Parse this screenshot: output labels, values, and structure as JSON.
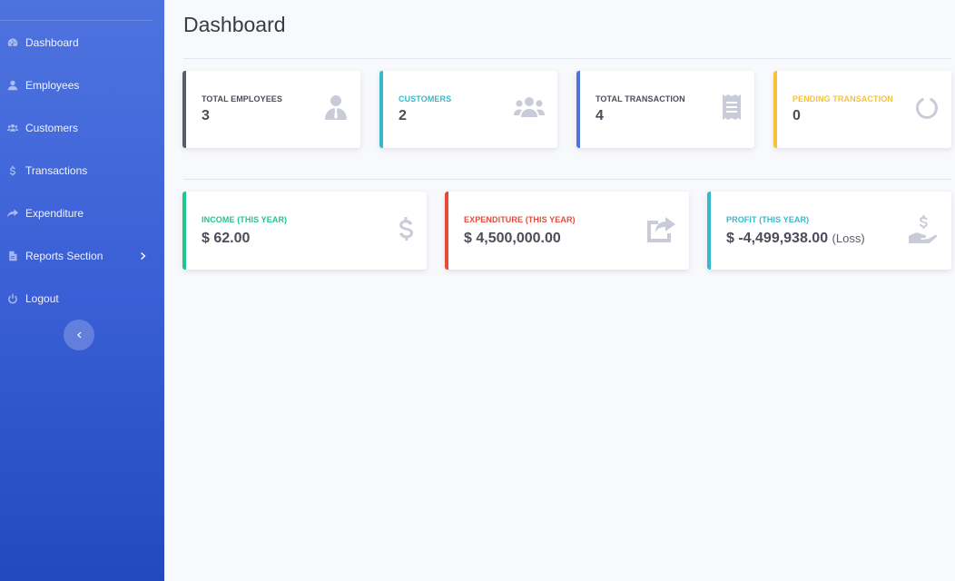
{
  "sidebar": {
    "items": [
      {
        "label": "Dashboard",
        "icon": "tachometer-icon"
      },
      {
        "label": "Employees",
        "icon": "user-icon"
      },
      {
        "label": "Customers",
        "icon": "users-icon"
      },
      {
        "label": "Transactions",
        "icon": "dollar-icon"
      },
      {
        "label": "Expenditure",
        "icon": "share-icon"
      },
      {
        "label": "Reports Section",
        "icon": "file-icon"
      },
      {
        "label": "Logout",
        "icon": "power-icon"
      }
    ]
  },
  "page": {
    "title": "Dashboard"
  },
  "stats": [
    {
      "label": "TOTAL EMPLOYEES",
      "value": "3",
      "color": "#5a5c69",
      "icon": "user-tie-icon"
    },
    {
      "label": "CUSTOMERS",
      "value": "2",
      "color": "#36b9cc",
      "icon": "users-icon"
    },
    {
      "label": "TOTAL TRANSACTION",
      "value": "4",
      "color": "#4e73df",
      "icon": "receipt-icon"
    },
    {
      "label": "PENDING TRANSACTION",
      "value": "0",
      "color": "#f6c23e",
      "icon": "circle-notch-icon"
    }
  ],
  "finance": [
    {
      "label": "INCOME (THIS YEAR)",
      "value": "$ 62.00",
      "color": "#1cc88a",
      "icon": "dollar-icon"
    },
    {
      "label": "EXPENDITURE (THIS YEAR)",
      "value": "$ 4,500,000.00",
      "color": "#e74a3b",
      "icon": "share-square-icon"
    },
    {
      "label": "PROFIT (THIS YEAR)",
      "value": "$ -4,499,938.00",
      "note": "(Loss)",
      "color": "#36b9cc",
      "icon": "hand-holding-usd-icon"
    }
  ]
}
